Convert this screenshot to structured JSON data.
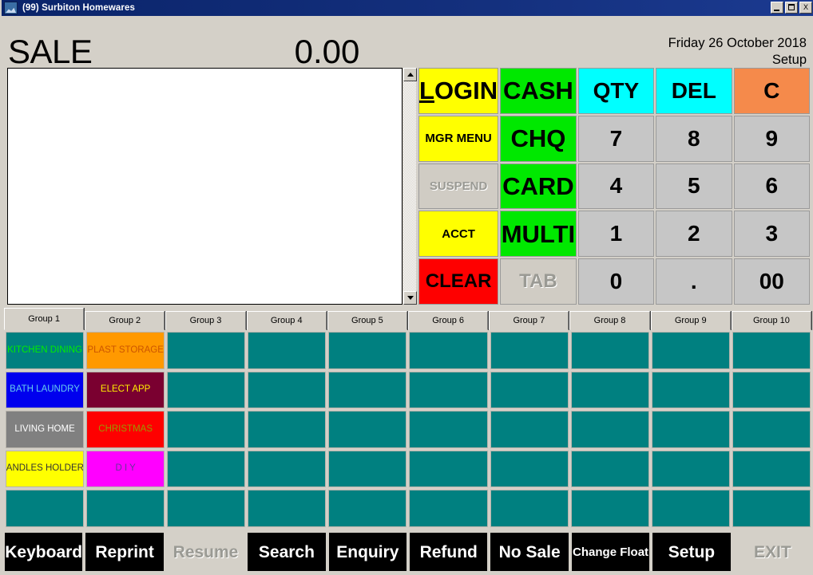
{
  "window": {
    "title": "(99) Surbiton Homewares",
    "icon": "app-icon",
    "minimize_label": "",
    "maximize_label": "",
    "close_label": "X"
  },
  "header": {
    "mode": "SALE",
    "amount": "0.00",
    "date": "Friday 26 October 2018",
    "setup_label": "Setup"
  },
  "receipt": {
    "lines": []
  },
  "keypad": {
    "keys": [
      {
        "label": "LOGIN",
        "accel": "L",
        "color": "yellow",
        "size": "f-xl",
        "disabled": false
      },
      {
        "label": "CASH",
        "color": "green",
        "size": "f-xl",
        "disabled": false
      },
      {
        "label": "QTY",
        "color": "cyan",
        "size": "f-lg",
        "disabled": false
      },
      {
        "label": "DEL",
        "color": "cyan",
        "size": "f-lg",
        "disabled": false
      },
      {
        "label": "C",
        "color": "orange",
        "size": "f-lg",
        "disabled": false
      },
      {
        "label": "MGR MENU",
        "color": "yellow",
        "size": "f-sm",
        "disabled": false
      },
      {
        "label": "CHQ",
        "color": "green",
        "size": "f-xl",
        "disabled": false
      },
      {
        "label": "7",
        "color": "grey",
        "size": "f-lg",
        "disabled": false
      },
      {
        "label": "8",
        "color": "grey",
        "size": "f-lg",
        "disabled": false
      },
      {
        "label": "9",
        "color": "grey",
        "size": "f-lg",
        "disabled": false
      },
      {
        "label": "SUSPEND",
        "color": "grey",
        "size": "f-sm",
        "disabled": true
      },
      {
        "label": "CARD",
        "color": "green",
        "size": "f-xl",
        "disabled": false
      },
      {
        "label": "4",
        "color": "grey",
        "size": "f-lg",
        "disabled": false
      },
      {
        "label": "5",
        "color": "grey",
        "size": "f-lg",
        "disabled": false
      },
      {
        "label": "6",
        "color": "grey",
        "size": "f-lg",
        "disabled": false
      },
      {
        "label": "ACCT",
        "color": "yellow",
        "size": "f-sm",
        "disabled": false
      },
      {
        "label": "MULTI",
        "color": "green",
        "size": "f-xl",
        "disabled": false
      },
      {
        "label": "1",
        "color": "grey",
        "size": "f-lg",
        "disabled": false
      },
      {
        "label": "2",
        "color": "grey",
        "size": "f-lg",
        "disabled": false
      },
      {
        "label": "3",
        "color": "grey",
        "size": "f-lg",
        "disabled": false
      },
      {
        "label": "CLEAR",
        "color": "red",
        "size": "f-md",
        "disabled": false
      },
      {
        "label": "TAB",
        "color": "grey",
        "size": "f-md",
        "disabled": true
      },
      {
        "label": "0",
        "color": "grey",
        "size": "f-lg",
        "disabled": false
      },
      {
        "label": ".",
        "color": "grey",
        "size": "f-lg",
        "disabled": false
      },
      {
        "label": "00",
        "color": "grey",
        "size": "f-lg",
        "disabled": false
      }
    ]
  },
  "group_tabs": {
    "active_index": 0,
    "items": [
      {
        "label": "Group 1"
      },
      {
        "label": "Group 2"
      },
      {
        "label": "Group 3"
      },
      {
        "label": "Group 4"
      },
      {
        "label": "Group 5"
      },
      {
        "label": "Group 6"
      },
      {
        "label": "Group 7"
      },
      {
        "label": "Group 8"
      },
      {
        "label": "Group 9"
      },
      {
        "label": "Group 10"
      }
    ]
  },
  "product_grid": {
    "columns": 10,
    "rows": 5,
    "empty_color": "#008080",
    "buttons": [
      {
        "label": "KITCHEN DINING",
        "bg": "#008080",
        "fg": "#00ee00"
      },
      {
        "label": "PLAST STORAGE",
        "bg": "#ff9900",
        "fg": "#cc5500"
      },
      {
        "label": "",
        "bg": "#008080",
        "fg": "#ffffff"
      },
      {
        "label": "",
        "bg": "#008080",
        "fg": "#ffffff"
      },
      {
        "label": "",
        "bg": "#008080",
        "fg": "#ffffff"
      },
      {
        "label": "",
        "bg": "#008080",
        "fg": "#ffffff"
      },
      {
        "label": "",
        "bg": "#008080",
        "fg": "#ffffff"
      },
      {
        "label": "",
        "bg": "#008080",
        "fg": "#ffffff"
      },
      {
        "label": "",
        "bg": "#008080",
        "fg": "#ffffff"
      },
      {
        "label": "",
        "bg": "#008080",
        "fg": "#ffffff"
      },
      {
        "label": "BATH LAUNDRY",
        "bg": "#0000ee",
        "fg": "#66ccee"
      },
      {
        "label": "ELECT APP",
        "bg": "#7a0030",
        "fg": "#ffee00"
      },
      {
        "label": "",
        "bg": "#008080",
        "fg": "#ffffff"
      },
      {
        "label": "",
        "bg": "#008080",
        "fg": "#ffffff"
      },
      {
        "label": "",
        "bg": "#008080",
        "fg": "#ffffff"
      },
      {
        "label": "",
        "bg": "#008080",
        "fg": "#ffffff"
      },
      {
        "label": "",
        "bg": "#008080",
        "fg": "#ffffff"
      },
      {
        "label": "",
        "bg": "#008080",
        "fg": "#ffffff"
      },
      {
        "label": "",
        "bg": "#008080",
        "fg": "#ffffff"
      },
      {
        "label": "",
        "bg": "#008080",
        "fg": "#ffffff"
      },
      {
        "label": "LIVING HOME",
        "bg": "#808080",
        "fg": "#ffffff"
      },
      {
        "label": "CHRISTMAS",
        "bg": "#fe0000",
        "fg": "#999900"
      },
      {
        "label": "",
        "bg": "#008080",
        "fg": "#ffffff"
      },
      {
        "label": "",
        "bg": "#008080",
        "fg": "#ffffff"
      },
      {
        "label": "",
        "bg": "#008080",
        "fg": "#ffffff"
      },
      {
        "label": "",
        "bg": "#008080",
        "fg": "#ffffff"
      },
      {
        "label": "",
        "bg": "#008080",
        "fg": "#ffffff"
      },
      {
        "label": "",
        "bg": "#008080",
        "fg": "#ffffff"
      },
      {
        "label": "",
        "bg": "#008080",
        "fg": "#ffffff"
      },
      {
        "label": "",
        "bg": "#008080",
        "fg": "#ffffff"
      },
      {
        "label": "CANDLES HOLDERS",
        "bg": "#ffff00",
        "fg": "#333333"
      },
      {
        "label": "D I Y",
        "bg": "#ff00ff",
        "fg": "#663399"
      },
      {
        "label": "",
        "bg": "#008080",
        "fg": "#ffffff"
      },
      {
        "label": "",
        "bg": "#008080",
        "fg": "#ffffff"
      },
      {
        "label": "",
        "bg": "#008080",
        "fg": "#ffffff"
      },
      {
        "label": "",
        "bg": "#008080",
        "fg": "#ffffff"
      },
      {
        "label": "",
        "bg": "#008080",
        "fg": "#ffffff"
      },
      {
        "label": "",
        "bg": "#008080",
        "fg": "#ffffff"
      },
      {
        "label": "",
        "bg": "#008080",
        "fg": "#ffffff"
      },
      {
        "label": "",
        "bg": "#008080",
        "fg": "#ffffff"
      },
      {
        "label": "",
        "bg": "#008080",
        "fg": "#ffffff"
      },
      {
        "label": "",
        "bg": "#008080",
        "fg": "#ffffff"
      },
      {
        "label": "",
        "bg": "#008080",
        "fg": "#ffffff"
      },
      {
        "label": "",
        "bg": "#008080",
        "fg": "#ffffff"
      },
      {
        "label": "",
        "bg": "#008080",
        "fg": "#ffffff"
      },
      {
        "label": "",
        "bg": "#008080",
        "fg": "#ffffff"
      },
      {
        "label": "",
        "bg": "#008080",
        "fg": "#ffffff"
      },
      {
        "label": "",
        "bg": "#008080",
        "fg": "#ffffff"
      },
      {
        "label": "",
        "bg": "#008080",
        "fg": "#ffffff"
      },
      {
        "label": "",
        "bg": "#008080",
        "fg": "#ffffff"
      }
    ]
  },
  "toolbar": {
    "buttons": [
      {
        "label": "Keyboard",
        "disabled": false,
        "small": false
      },
      {
        "label": "Reprint",
        "disabled": false,
        "small": false
      },
      {
        "label": "Resume",
        "disabled": true,
        "small": false
      },
      {
        "label": "Search",
        "disabled": false,
        "small": false
      },
      {
        "label": "Enquiry",
        "disabled": false,
        "small": false
      },
      {
        "label": "Refund",
        "disabled": false,
        "small": false
      },
      {
        "label": "No Sale",
        "disabled": false,
        "small": false
      },
      {
        "label": "Change Float",
        "disabled": false,
        "small": true
      },
      {
        "label": "Setup",
        "disabled": false,
        "small": false
      },
      {
        "label": "EXIT",
        "disabled": true,
        "small": false
      }
    ]
  }
}
